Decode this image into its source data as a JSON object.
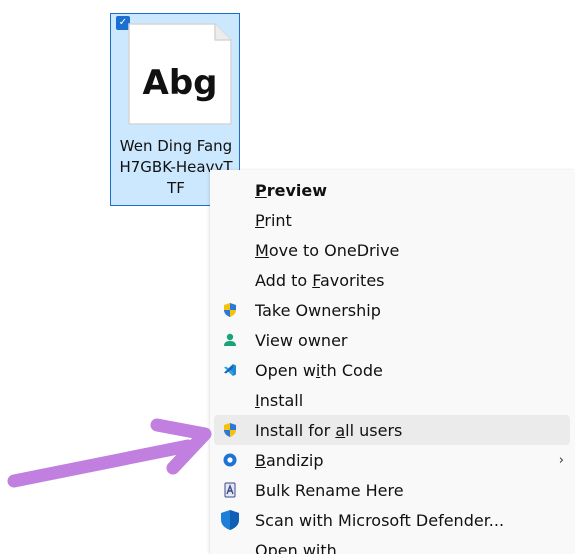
{
  "file": {
    "name_line1": "Wen Ding Fang",
    "name_line2": "H7GBK-HeavyT",
    "name_line3": "TF",
    "preview_text": "Abg",
    "selected": true
  },
  "menu": {
    "items": [
      {
        "pre": "",
        "u": "P",
        "post": "review",
        "bold": true,
        "icon": ""
      },
      {
        "pre": "",
        "u": "P",
        "post": "rint",
        "icon": ""
      },
      {
        "pre": "",
        "u": "M",
        "post": "ove to OneDrive",
        "icon": ""
      },
      {
        "pre": "Add to ",
        "u": "F",
        "post": "avorites",
        "icon": ""
      },
      {
        "pre": "Take Ownership",
        "u": "",
        "post": "",
        "icon": "shield-icon"
      },
      {
        "pre": "View owner",
        "u": "",
        "post": "",
        "icon": "user-icon"
      },
      {
        "pre": "Open w",
        "u": "i",
        "post": "th Code",
        "icon": "vscode-icon"
      },
      {
        "pre": "",
        "u": "I",
        "post": "nstall",
        "icon": ""
      },
      {
        "pre": "Install for ",
        "u": "a",
        "post": "ll users",
        "icon": "shield-icon",
        "hover": true
      },
      {
        "pre": "",
        "u": "B",
        "post": "andizip",
        "icon": "bandizip-icon",
        "submenu": true
      },
      {
        "pre": "Bulk Rename Here",
        "u": "",
        "post": "",
        "icon": "bulk-rename-icon"
      },
      {
        "pre": "Scan with Microsoft Defender...",
        "u": "",
        "post": "",
        "icon": "defender-icon"
      },
      {
        "pre": "Open with...",
        "u": "",
        "post": "",
        "icon": ""
      }
    ],
    "submenu_arrow": "›"
  },
  "colors": {
    "selection": "#cce8ff",
    "selection_border": "#1a6fd1",
    "annotation_arrow": "#c17fe0"
  }
}
